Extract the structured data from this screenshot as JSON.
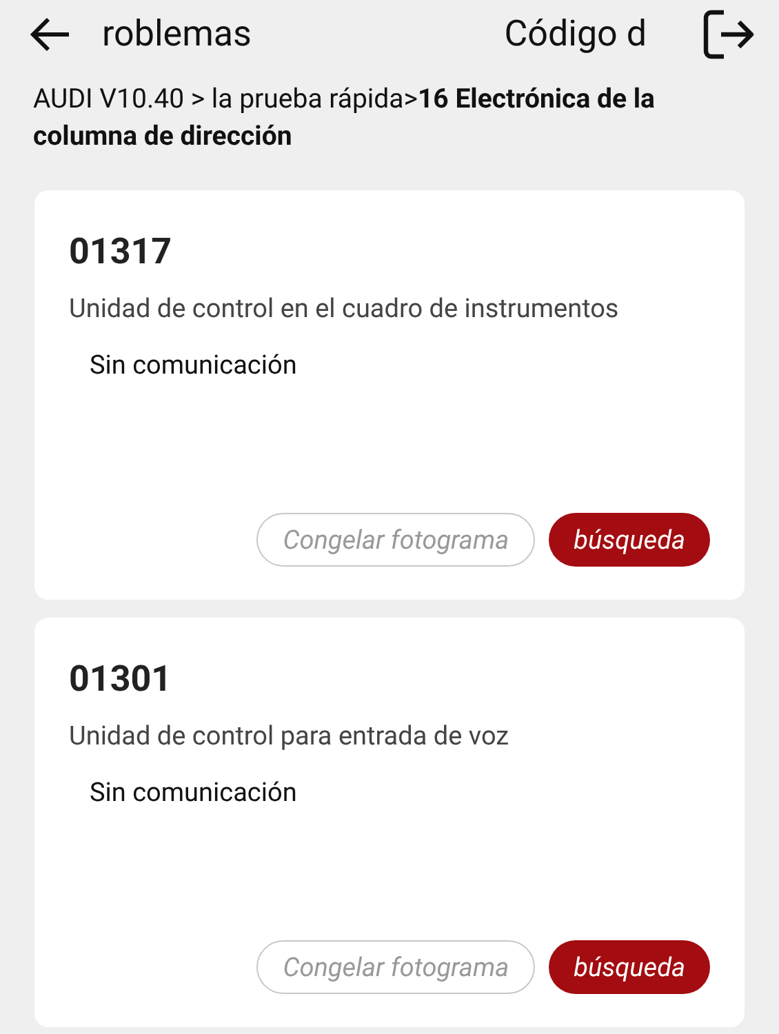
{
  "header": {
    "title_left": "roblemas",
    "title_right": "Código d"
  },
  "breadcrumb": "AUDI V10.40 > la prueba rápida>**16 Electrónica de la columna de dirección**",
  "faults": [
    {
      "code": "01317",
      "description": "Unidad de control en el cuadro de instrumentos",
      "status": "Sin comunicación",
      "buttons": [
        "Congelar fotograma",
        "búsqueda"
      ]
    },
    {
      "code": "01301",
      "description": "Unidad de control para entrada de voz",
      "status": "Sin comunicación",
      "buttons": [
        "Congelar fotograma",
        "búsqueda"
      ]
    }
  ]
}
